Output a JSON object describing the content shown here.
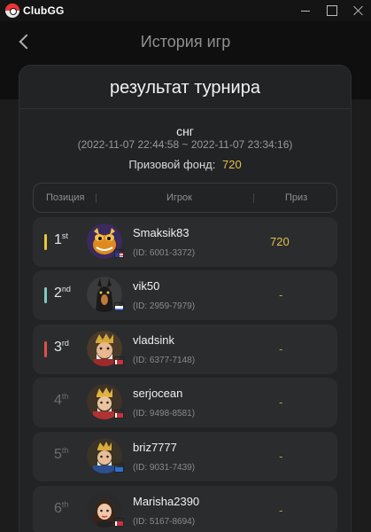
{
  "app": {
    "brand": "ClubGG"
  },
  "header": {
    "title": "История игр"
  },
  "modal": {
    "title": "результат турнира",
    "event_name": "снг",
    "date_range": "(2022-11-07 22:44:58 ~ 2022-11-07 23:34:16)",
    "prize_pool_label": "Призовой фонд:",
    "prize_pool_value": "720"
  },
  "table": {
    "headers": {
      "position": "Позиция",
      "player": "Игрок",
      "prize": "Приз"
    },
    "rows": [
      {
        "rank": "1",
        "suffix": "st",
        "name": "Smaksik83",
        "id": "(ID: 6001-3372)",
        "prize": "720",
        "bar_color": "#e8c53a",
        "flag": "us"
      },
      {
        "rank": "2",
        "suffix": "nd",
        "name": "vik50",
        "id": "(ID: 2959-7979)",
        "prize": "-",
        "bar_color": "#7fc9c0",
        "flag": "ru"
      },
      {
        "rank": "3",
        "suffix": "rd",
        "name": "vladsink",
        "id": "(ID: 6377-7148)",
        "prize": "-",
        "bar_color": "#e04e4e",
        "flag": "by"
      },
      {
        "rank": "4",
        "suffix": "th",
        "name": "serjocean",
        "id": "(ID: 9498-8581)",
        "prize": "-",
        "bar_color": "",
        "flag": "by"
      },
      {
        "rank": "5",
        "suffix": "th",
        "name": "briz7777",
        "id": "(ID: 9031-7439)",
        "prize": "-",
        "bar_color": "",
        "flag": "ua"
      },
      {
        "rank": "6",
        "suffix": "th",
        "name": "Marisha2390",
        "id": "(ID: 5167-8694)",
        "prize": "-",
        "bar_color": "",
        "flag": "by"
      }
    ]
  }
}
